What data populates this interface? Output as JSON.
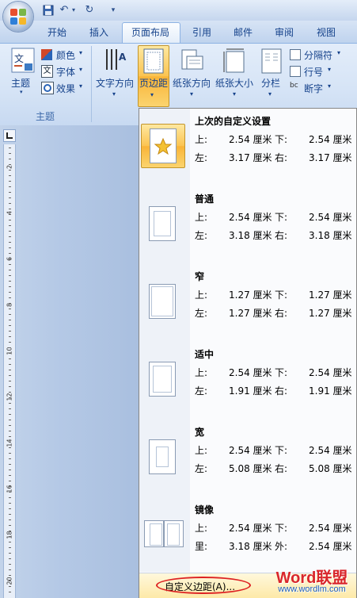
{
  "ribbon": {
    "tabs": [
      "开始",
      "插入",
      "页面布局",
      "引用",
      "邮件",
      "审阅",
      "视图"
    ],
    "active_tab": "页面布局",
    "theme_group": {
      "label": "主题",
      "themes_button": "主题",
      "colors": "颜色",
      "fonts": "字体",
      "effects": "效果"
    },
    "page_setup": {
      "text_direction": "文字方向",
      "margins": "页边距",
      "orientation": "纸张方向",
      "size": "纸张大小",
      "columns": "分栏",
      "breaks": "分隔符",
      "line_numbers": "行号",
      "hyphenation": "断字"
    }
  },
  "margins_menu": {
    "items": [
      {
        "name": "上次的自定义设置",
        "r1_left_label": "上:",
        "r1_left": "2.54 厘米",
        "r1_right_label": "下:",
        "r1_right": "2.54 厘米",
        "r2_left_label": "左:",
        "r2_left": "3.17 厘米",
        "r2_right_label": "右:",
        "r2_right": "3.17 厘米"
      },
      {
        "name": "普通",
        "r1_left_label": "上:",
        "r1_left": "2.54 厘米",
        "r1_right_label": "下:",
        "r1_right": "2.54 厘米",
        "r2_left_label": "左:",
        "r2_left": "3.18 厘米",
        "r2_right_label": "右:",
        "r2_right": "3.18 厘米"
      },
      {
        "name": "窄",
        "r1_left_label": "上:",
        "r1_left": "1.27 厘米",
        "r1_right_label": "下:",
        "r1_right": "1.27 厘米",
        "r2_left_label": "左:",
        "r2_left": "1.27 厘米",
        "r2_right_label": "右:",
        "r2_right": "1.27 厘米"
      },
      {
        "name": "适中",
        "r1_left_label": "上:",
        "r1_left": "2.54 厘米",
        "r1_right_label": "下:",
        "r1_right": "2.54 厘米",
        "r2_left_label": "左:",
        "r2_left": "1.91 厘米",
        "r2_right_label": "右:",
        "r2_right": "1.91 厘米"
      },
      {
        "name": "宽",
        "r1_left_label": "上:",
        "r1_left": "2.54 厘米",
        "r1_right_label": "下:",
        "r1_right": "2.54 厘米",
        "r2_left_label": "左:",
        "r2_left": "5.08 厘米",
        "r2_right_label": "右:",
        "r2_right": "5.08 厘米"
      },
      {
        "name": "镜像",
        "r1_left_label": "上:",
        "r1_left": "2.54 厘米",
        "r1_right_label": "下:",
        "r1_right": "2.54 厘米",
        "r2_left_label": "里:",
        "r2_left": "3.18 厘米",
        "r2_right_label": "外:",
        "r2_right": "2.54 厘米"
      }
    ],
    "custom_margins": "自定义边距(A)..."
  },
  "ruler_numbers": [
    "2",
    "4",
    "6",
    "8",
    "10",
    "12",
    "14",
    "16",
    "18",
    "20"
  ],
  "watermark": {
    "brand": "Word联盟",
    "url": "www.wordlm.com"
  },
  "colors": {
    "highlight": "#fbc451",
    "custom_oval": "#dd2222",
    "watermark_red": "#d9262b",
    "watermark_blue": "#1f5fbf"
  }
}
